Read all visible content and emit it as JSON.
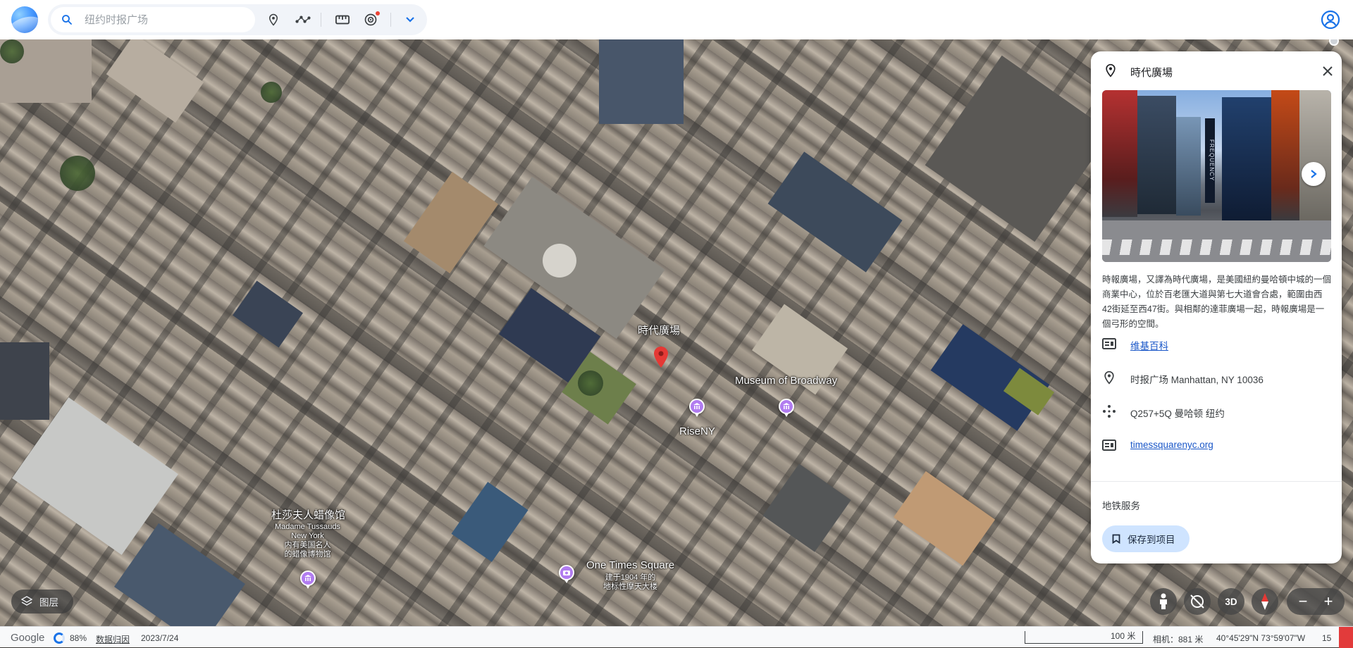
{
  "search": {
    "placeholder": "纽约时报广场"
  },
  "map_labels": {
    "times_square": "時代廣場",
    "museum_of_broadway": "Museum of Broadway",
    "riseny": "RiseNY",
    "madame_tussauds_cn": "杜莎夫人蜡像馆",
    "madame_tussauds_en1": "Madame Tussauds",
    "madame_tussauds_en2": "New York",
    "madame_tussauds_sub1": "内有美国名人",
    "madame_tussauds_sub2": "的蜡像博物馆",
    "one_times_square": "One Times Square",
    "one_times_square_sub1": "建于1904 年的",
    "one_times_square_sub2": "地标性摩天大楼"
  },
  "panel": {
    "title": "時代廣場",
    "photo_sign": "FREQUENCY",
    "description": "時報廣場，又譯為時代廣場，是美國紐約曼哈頓中城的一個商業中心，位於百老匯大道與第七大道會合處，範圍由西42街延至西47街。與相鄰的達菲廣場一起，時報廣場是一個弓形的空間。",
    "wiki": "维基百科",
    "address": "时报广场 Manhattan, NY 10036",
    "plus_code": "Q257+5Q 曼哈顿 纽约",
    "website": "timessquarenyc.org",
    "subway": "地铁服务",
    "save": "保存到项目"
  },
  "controls": {
    "layers": "图层",
    "three_d": "3D",
    "zoom_out": "−",
    "zoom_in": "+"
  },
  "status": {
    "brand": "Google",
    "progress": "88%",
    "attribution": "数据归因",
    "date": "2023/7/24",
    "scale": "100 米",
    "camera": "相机：881 米",
    "coords": "40°45'29\"N 73°59'07\"W",
    "altitude": "15"
  },
  "colors": {
    "accent": "#1a73e8",
    "poi": "#b17cf0",
    "pin": "#e53935",
    "save_bg": "#cfe4ff"
  }
}
